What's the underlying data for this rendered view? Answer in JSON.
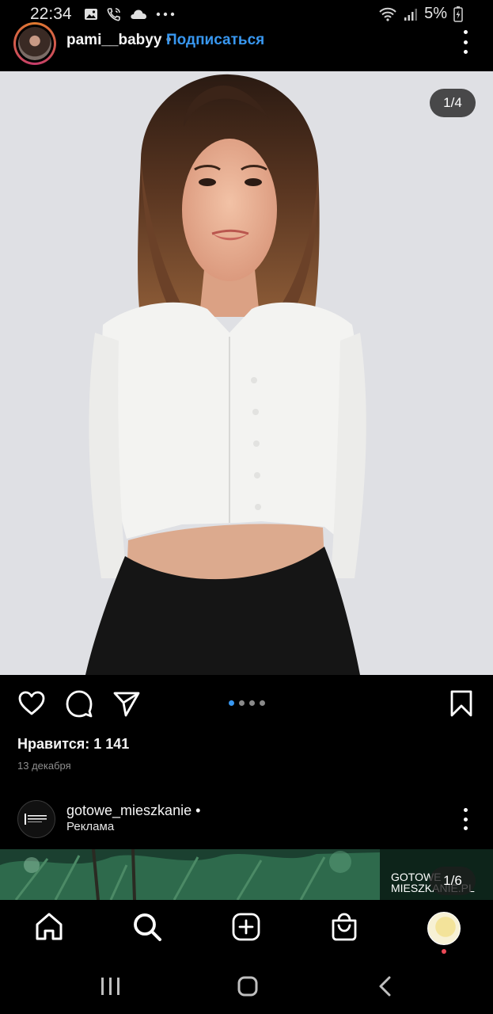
{
  "status_bar": {
    "time": "22:34",
    "battery": "5%",
    "icons": [
      "gallery-icon",
      "wifi-call-icon",
      "cloud-icon",
      "more-dots-icon",
      "wifi-icon",
      "signal-icon",
      "battery-icon"
    ]
  },
  "post": {
    "username": "pami__babyy",
    "separator": "•",
    "follow_label": "Подписаться",
    "photo_counter": "1/4",
    "carousel_total": 4,
    "carousel_active": 1,
    "likes_text": "Нравится: 1 141",
    "date": "13 декабря"
  },
  "ad_post": {
    "username": "gotowe_mieszkanie",
    "separator": "•",
    "label": "Реклама",
    "photo_counter": "1/6",
    "brand_line1": "GOTOWE",
    "brand_line2": "MIESZKANIE.PL"
  },
  "colors": {
    "accent": "#3897f0",
    "background": "#000000",
    "notification": "#ed4956"
  },
  "bottom_nav": [
    "home-icon",
    "search-icon",
    "new-post-icon",
    "shop-icon",
    "profile-avatar"
  ],
  "android_nav": [
    "recent-apps-icon",
    "home-button-icon",
    "back-icon"
  ]
}
